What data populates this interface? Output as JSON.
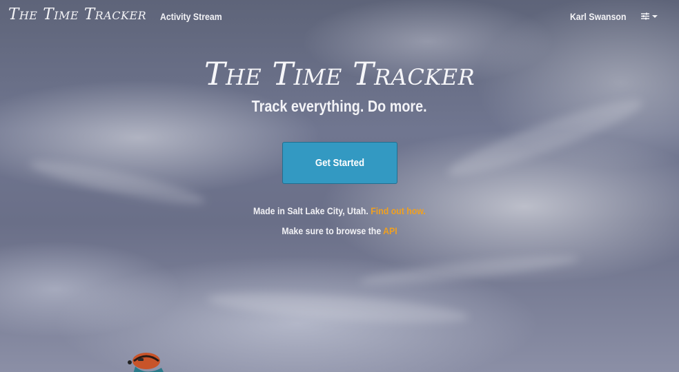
{
  "navbar": {
    "brand": "The Time Tracker",
    "links": [
      {
        "label": "Activity Stream"
      }
    ],
    "user_name": "Karl Swanson",
    "settings_icon": "sliders-icon"
  },
  "hero": {
    "title": "The Time Tracker",
    "tagline": "Track everything. Do more.",
    "cta_label": "Get Started",
    "made_in_text": "Made in Salt Lake City, Utah.",
    "made_in_link": "Find out how.",
    "api_text": "Make sure to browse the",
    "api_link": "API"
  },
  "colors": {
    "accent_link": "#f0a020",
    "button": "#3399c2"
  }
}
